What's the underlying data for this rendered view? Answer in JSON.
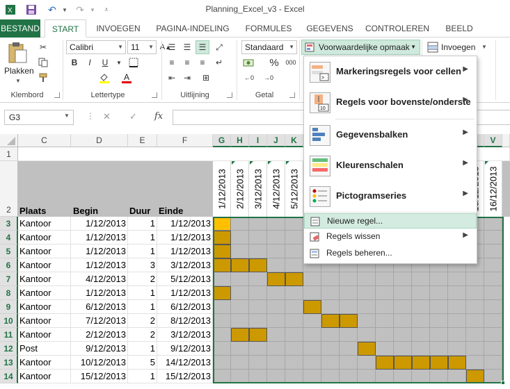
{
  "window": {
    "title": "Planning_Excel_v3 - Excel"
  },
  "quick_access": {
    "save_icon": "save-icon",
    "undo_icon": "undo-icon",
    "redo_icon": "redo-icon"
  },
  "tabs": [
    "BESTAND",
    "START",
    "INVOEGEN",
    "PAGINA-INDELING",
    "FORMULES",
    "GEGEVENS",
    "CONTROLEREN",
    "BEELD"
  ],
  "ribbon": {
    "clipboard": {
      "paste_label": "Plakken",
      "group_label": "Klembord"
    },
    "font": {
      "font_name": "Calibri",
      "font_size": "11",
      "group_label": "Lettertype",
      "bold": "B",
      "italic": "I",
      "underline": "U"
    },
    "alignment": {
      "group_label": "Uitlijning"
    },
    "number": {
      "format": "Standaard",
      "group_label": "Getal",
      "percent": "%",
      "thousands": "000"
    },
    "styles": {
      "conditional_label": "Voorwaardelijke opmaak"
    },
    "cells": {
      "insert_label": "Invoegen"
    }
  },
  "formula_bar": {
    "name_box": "G3",
    "fx": "fx",
    "cancel": "✕",
    "enter": "✓",
    "value": ""
  },
  "columns": [
    "C",
    "D",
    "E",
    "F",
    "G",
    "H",
    "I",
    "J",
    "K",
    "U",
    "V"
  ],
  "rows": [
    "1",
    "2",
    "3",
    "4",
    "5",
    "6",
    "7",
    "8",
    "9",
    "10",
    "11",
    "12",
    "13",
    "14"
  ],
  "headers": {
    "plaats": "Plaats",
    "begin": "Begin",
    "duur": "Duur",
    "einde": "Einde"
  },
  "date_headers": [
    "1/12/2013",
    "2/12/2013",
    "3/12/2013",
    "4/12/2013",
    "5/12/2013",
    "15/12/2013",
    "16/12/2013"
  ],
  "table": [
    {
      "plaats": "Kantoor",
      "begin": "1/12/2013",
      "duur": "1",
      "einde": "1/12/2013"
    },
    {
      "plaats": "Kantoor",
      "begin": "1/12/2013",
      "duur": "1",
      "einde": "1/12/2013"
    },
    {
      "plaats": "Kantoor",
      "begin": "1/12/2013",
      "duur": "1",
      "einde": "1/12/2013"
    },
    {
      "plaats": "Kantoor",
      "begin": "1/12/2013",
      "duur": "3",
      "einde": "3/12/2013"
    },
    {
      "plaats": "Kantoor",
      "begin": "4/12/2013",
      "duur": "2",
      "einde": "5/12/2013"
    },
    {
      "plaats": "Kantoor",
      "begin": "1/12/2013",
      "duur": "1",
      "einde": "1/12/2013"
    },
    {
      "plaats": "Kantoor",
      "begin": "6/12/2013",
      "duur": "1",
      "einde": "6/12/2013"
    },
    {
      "plaats": "Kantoor",
      "begin": "7/12/2013",
      "duur": "2",
      "einde": "8/12/2013"
    },
    {
      "plaats": "Kantoor",
      "begin": "2/12/2013",
      "duur": "2",
      "einde": "3/12/2013"
    },
    {
      "plaats": "Post",
      "begin": "9/12/2013",
      "duur": "1",
      "einde": "9/12/2013"
    },
    {
      "plaats": "Kantoor",
      "begin": "10/12/2013",
      "duur": "5",
      "einde": "14/12/2013"
    },
    {
      "plaats": "Kantoor",
      "begin": "15/12/2013",
      "duur": "1",
      "einde": "15/12/2013"
    }
  ],
  "menu": {
    "highlight_rules": "Markeringsregels voor cellen",
    "top_bottom": "Regels voor bovenste/onderste",
    "data_bars": "Gegevensbalken",
    "color_scales": "Kleurenschalen",
    "icon_sets": "Pictogramseries",
    "new_rule": "Nieuwe regel...",
    "clear_rules": "Regels wissen",
    "manage_rules": "Regels beheren..."
  },
  "colors": {
    "accent": "#217346",
    "gantt_fill": "#cc9900",
    "active_fill": "#ffc000",
    "grid_fill": "#c0c0c0"
  }
}
